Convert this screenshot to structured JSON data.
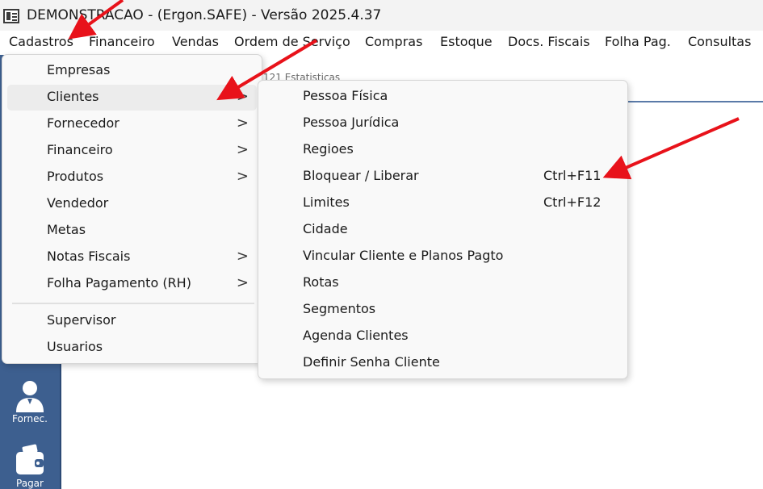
{
  "window": {
    "title": "DEMONSTRACAO - (Ergon.SAFE) - Versão 2025.4.37"
  },
  "menubar": {
    "items": [
      "Cadastros",
      "Financeiro",
      "Vendas",
      "Ordem de Serviço",
      "Compras",
      "Estoque",
      "Docs. Fiscais",
      "Folha Pag.",
      "Consultas"
    ]
  },
  "background": {
    "partial_label": "121 Estatisticas",
    "sidebar": [
      {
        "label": "Fornec.",
        "icon": "supplier-person-icon"
      },
      {
        "label": "Pagar",
        "icon": "wallet-icon"
      }
    ]
  },
  "cadastros_menu": {
    "items": [
      {
        "label": "Empresas",
        "submenu": false
      },
      {
        "label": "Clientes",
        "submenu": true,
        "highlighted": true
      },
      {
        "label": "Fornecedor",
        "submenu": true
      },
      {
        "label": "Financeiro",
        "submenu": true
      },
      {
        "label": "Produtos",
        "submenu": true
      },
      {
        "label": "Vendedor",
        "submenu": false
      },
      {
        "label": "Metas",
        "submenu": false
      },
      {
        "label": "Notas Fiscais",
        "submenu": true
      },
      {
        "label": "Folha Pagamento (RH)",
        "submenu": true
      },
      {
        "label": "Supervisor",
        "submenu": false
      },
      {
        "label": "Usuarios",
        "submenu": false
      }
    ],
    "chevron": ">"
  },
  "clientes_submenu": {
    "items": [
      {
        "label": "Pessoa Física",
        "shortcut": ""
      },
      {
        "label": "Pessoa Jurídica",
        "shortcut": ""
      },
      {
        "label": "Regioes",
        "shortcut": ""
      },
      {
        "label": "Bloquear / Liberar",
        "shortcut": "Ctrl+F11"
      },
      {
        "label": "Limites",
        "shortcut": "Ctrl+F12"
      },
      {
        "label": "Cidade",
        "shortcut": ""
      },
      {
        "label": "Vincular Cliente e Planos Pagto",
        "shortcut": ""
      },
      {
        "label": "Rotas",
        "shortcut": ""
      },
      {
        "label": "Segmentos",
        "shortcut": ""
      },
      {
        "label": "Agenda Clientes",
        "shortcut": ""
      },
      {
        "label": "Definir Senha Cliente",
        "shortcut": ""
      }
    ]
  },
  "colors": {
    "sidebar_bg": "#3d5f8f",
    "annotation_arrow": "#e8121a",
    "menu_bg": "#f9f9f9",
    "menu_hover": "#ececec"
  }
}
